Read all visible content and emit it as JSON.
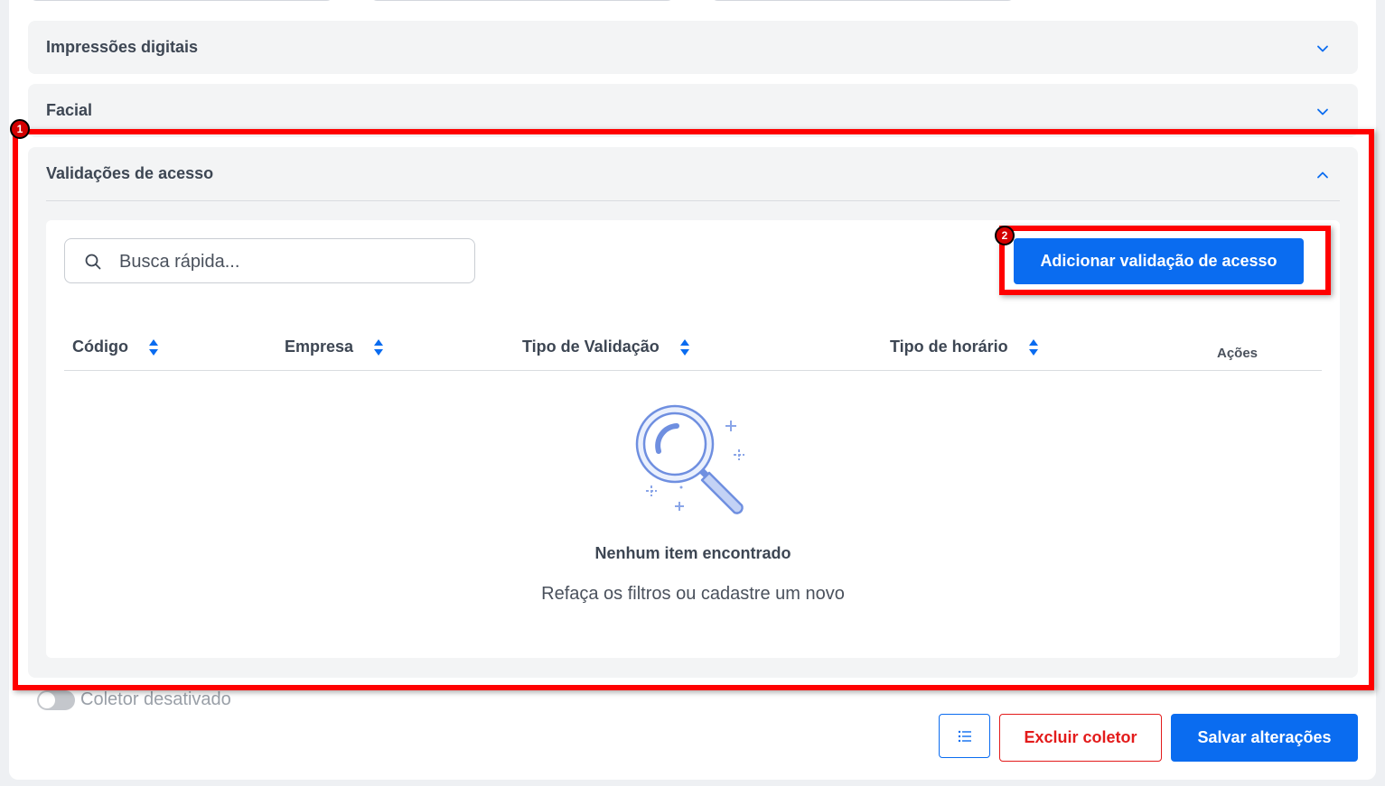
{
  "sections": {
    "fingerprints": {
      "title": "Impressões digitais"
    },
    "facial": {
      "title": "Facial"
    },
    "access_validations": {
      "title": "Validações de acesso"
    }
  },
  "search": {
    "placeholder": "Busca rápida..."
  },
  "add_button": {
    "label": "Adicionar validação de acesso"
  },
  "table": {
    "columns": [
      "Código",
      "Empresa",
      "Tipo de Validação",
      "Tipo de horário",
      "Ações"
    ]
  },
  "empty_state": {
    "title": "Nenhum item encontrado",
    "subtitle": "Refaça os filtros ou cadastre um novo"
  },
  "collector_toggle": {
    "label": "Coletor desativado",
    "enabled": false
  },
  "footer": {
    "delete_label": "Excluir coletor",
    "save_label": "Salvar alterações"
  },
  "annotations": {
    "badge_1": "1",
    "badge_2": "2"
  },
  "colors": {
    "primary": "#0a6cf0",
    "danger": "#e31b1b",
    "highlight": "#ff0000"
  }
}
